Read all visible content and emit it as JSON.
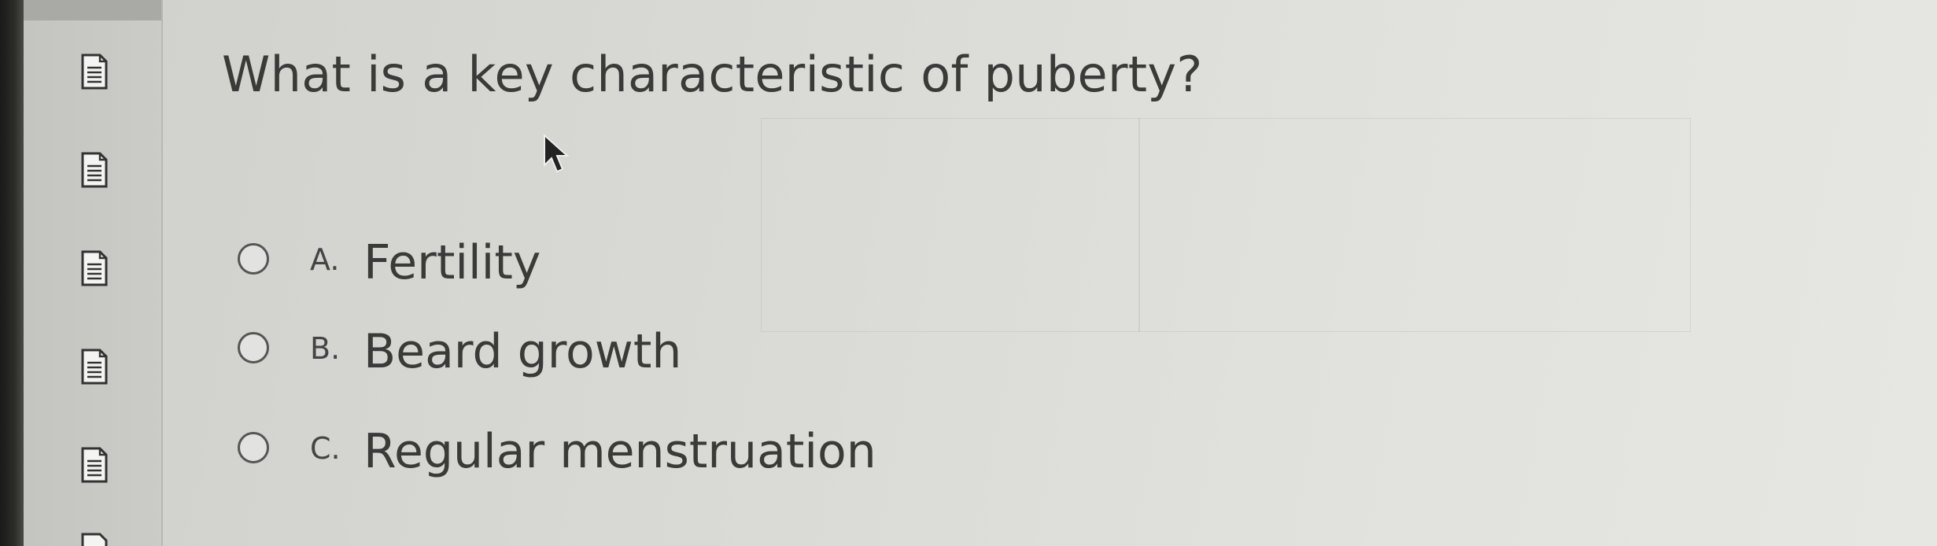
{
  "sidebar": {
    "items": [
      {
        "icon": "document-icon"
      },
      {
        "icon": "document-icon"
      },
      {
        "icon": "document-icon"
      },
      {
        "icon": "document-icon"
      },
      {
        "icon": "document-icon"
      }
    ]
  },
  "question": {
    "text": "What is a key characteristic of puberty?"
  },
  "options": [
    {
      "letter": "A.",
      "text": "Fertility",
      "selected": false
    },
    {
      "letter": "B.",
      "text": "Beard growth",
      "selected": false
    },
    {
      "letter": "C.",
      "text": "Regular menstruation",
      "selected": false
    }
  ],
  "colors": {
    "background": "#dcdcd8",
    "sidebar": "#c8c8c4",
    "text": "#3a3a38",
    "radio_border": "#555555"
  }
}
